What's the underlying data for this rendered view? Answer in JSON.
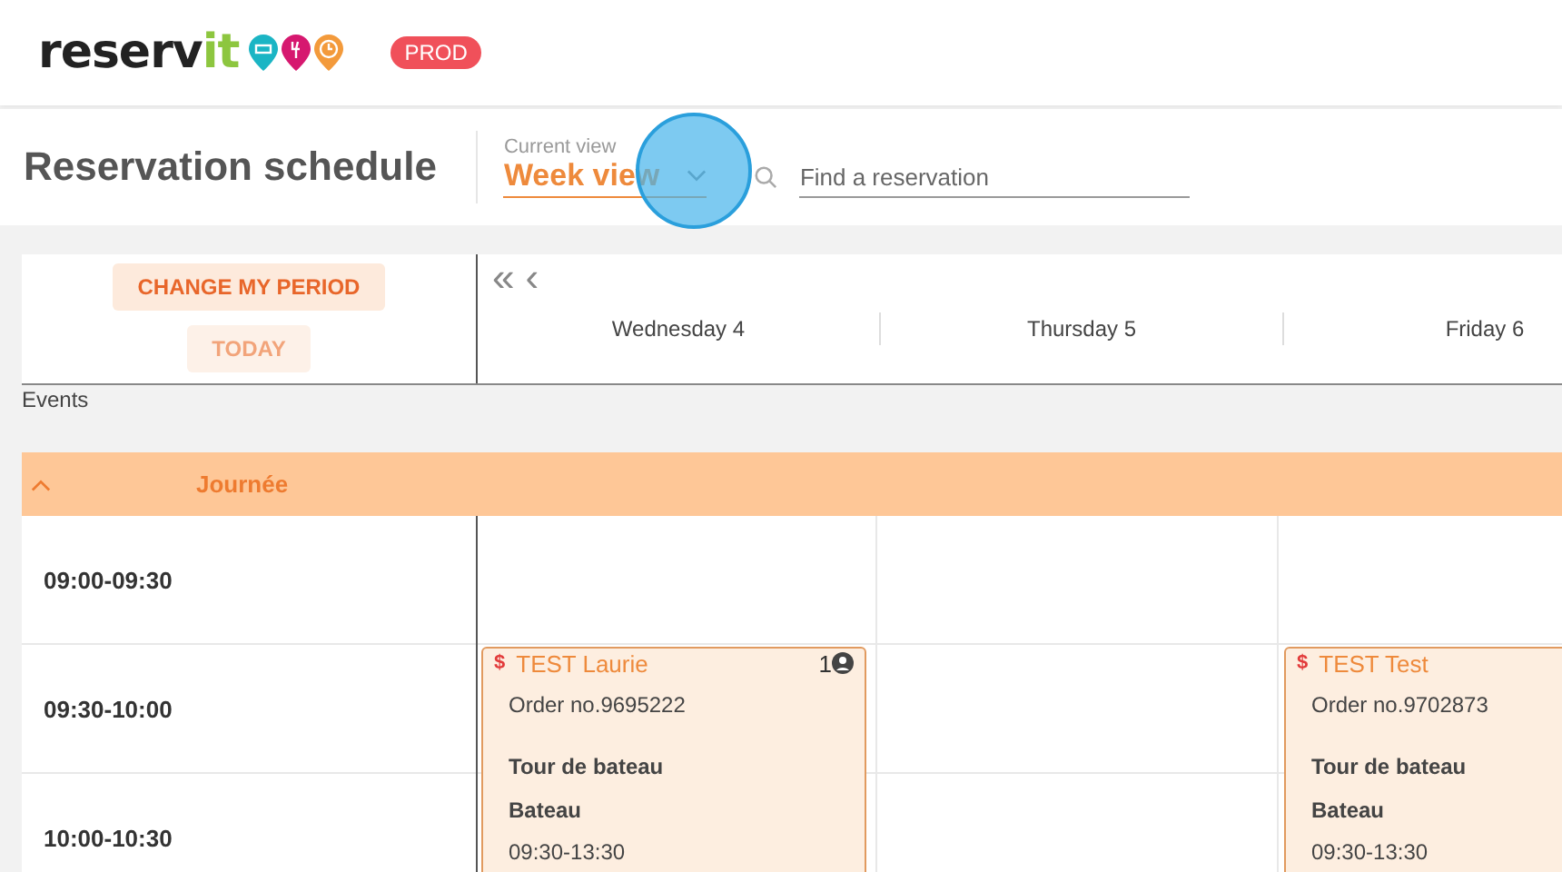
{
  "logo": {
    "text_dark": "reserv",
    "text_green": "it"
  },
  "environment_badge": "PROD",
  "page_title": "Reservation schedule",
  "view_select": {
    "label": "Current view",
    "value": "Week view"
  },
  "search": {
    "placeholder": "Find a reservation"
  },
  "period_buttons": {
    "change": "CHANGE MY PERIOD",
    "today": "TODAY"
  },
  "nav": {
    "first": "«",
    "previous": "‹"
  },
  "days": [
    {
      "label": "Wednesday 4",
      "reservations": [
        {
          "paid_mark": "$",
          "name": "TEST Laurie",
          "count": "1",
          "order": "Order no.9695222",
          "activity": "Tour de bateau",
          "resource": "Bateau",
          "time": "09:30-13:30"
        }
      ]
    },
    {
      "label": "Thursday 5"
    },
    {
      "label": "Friday 6",
      "reservations": [
        {
          "paid_mark": "$",
          "name": "TEST Test",
          "order": "Order no.9702873",
          "activity": "Tour de bateau",
          "resource": "Bateau",
          "time": "09:30-13:30"
        }
      ]
    }
  ],
  "events_label": "Events",
  "group": {
    "label": "Journée",
    "expanded": true
  },
  "slots": [
    "09:00-09:30",
    "09:30-10:00",
    "10:00-10:30"
  ]
}
